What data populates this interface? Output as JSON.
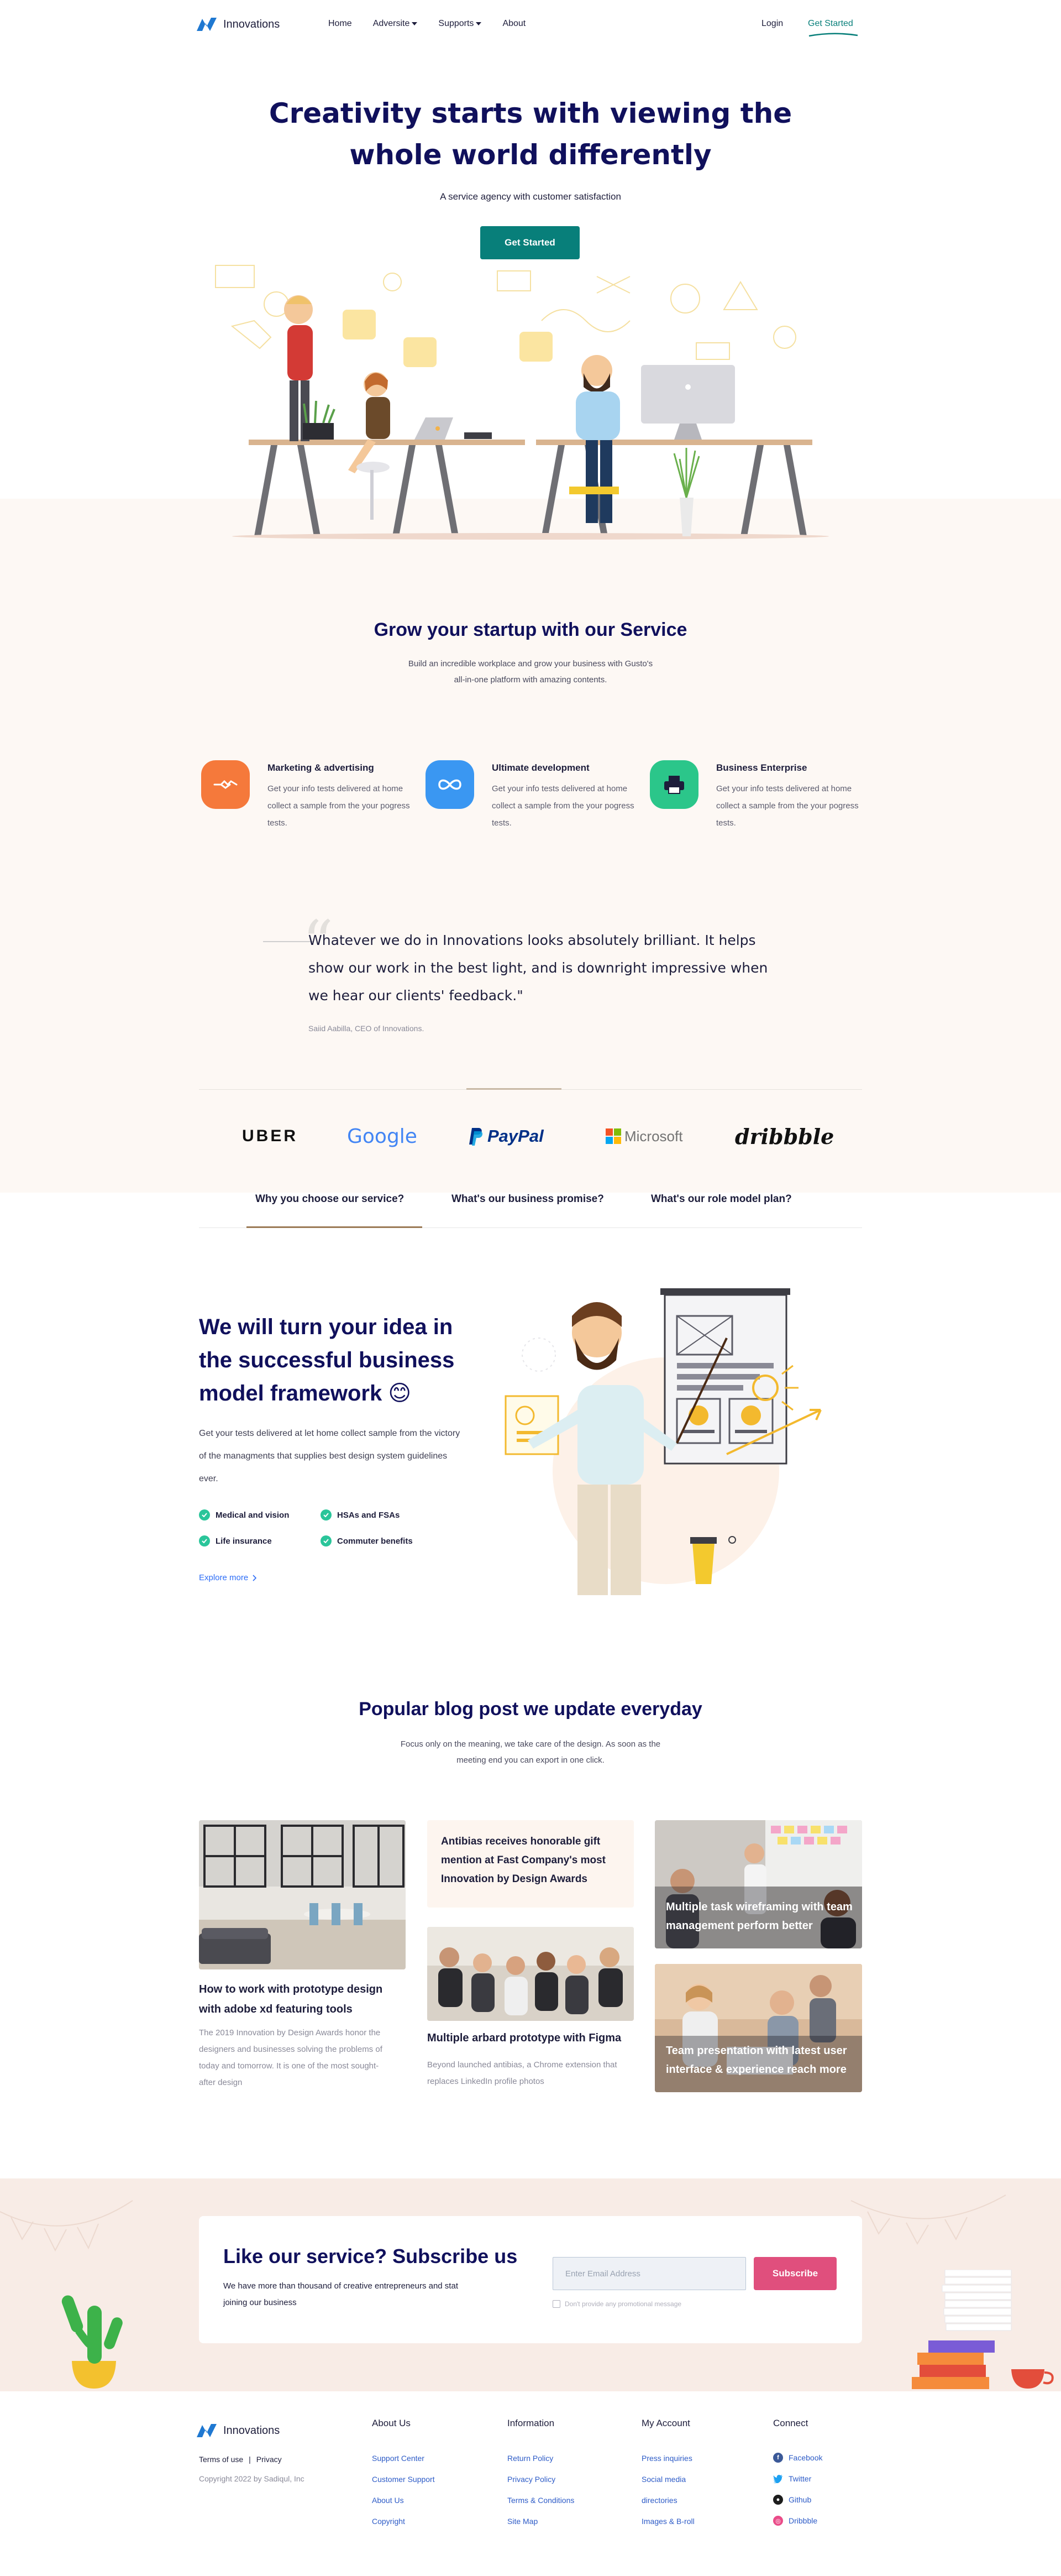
{
  "nav": {
    "logo_text": "Innovations",
    "links": [
      {
        "label": "Home",
        "dropdown": false
      },
      {
        "label": "Adversite",
        "dropdown": true
      },
      {
        "label": "Supports",
        "dropdown": true
      },
      {
        "label": "About",
        "dropdown": false
      }
    ],
    "login": "Login",
    "cta": "Get Started"
  },
  "hero": {
    "title_line1": "Creativity starts with viewing the",
    "title_line2": "whole world differently",
    "subtitle": "A service agency with customer satisfaction",
    "button": "Get Started"
  },
  "services": {
    "title": "Grow your startup with our Service",
    "subtitle_line1": "Build an incredible workplace and grow your business with Gusto's",
    "subtitle_line2": "all-in-one platform with amazing contents.",
    "features": [
      {
        "title": "Marketing & advertising",
        "text": "Get your info tests delivered at home collect a sample from the your pogress tests.",
        "icon": "handshake-icon",
        "color": "#f5793b"
      },
      {
        "title": "Ultimate development",
        "text": "Get your info tests delivered at home collect a sample from the your pogress tests.",
        "icon": "infinity-icon",
        "color": "#3a97f2"
      },
      {
        "title": "Business Enterprise",
        "text": "Get your info tests delivered at home collect a sample from the your pogress tests.",
        "icon": "printer-icon",
        "color": "#2bc68a"
      }
    ]
  },
  "testimonial": {
    "quote": "Whatever we do in Innovations looks absolutely brilliant. It helps show our work in the best light, and is downright impressive when we hear our clients' feedback.\"",
    "author": "Saiid Aabilla, CEO of Innovations."
  },
  "brands": [
    "UBER",
    "Google",
    "PayPal",
    "Microsoft",
    "dribbble"
  ],
  "tabs": [
    "Why you choose our service?",
    "What's our business promise?",
    "What's our role model plan?"
  ],
  "idea": {
    "title_line1": "We will turn your idea in",
    "title_line2": "the successful business",
    "title_line3": "model framework",
    "emoji": "😊",
    "text": "Get your tests delivered at let home collect sample from the victory of the managments that supplies best design system guidelines ever.",
    "checks": [
      "Medical and vision",
      "HSAs and FSAs",
      "Life insurance",
      "Commuter benefits"
    ],
    "explore": "Explore more"
  },
  "blog": {
    "title": "Popular blog post we update everyday",
    "subtitle_line1": "Focus only on the meaning, we take care of the design. As soon as the",
    "subtitle_line2": "meeting end you can export in one click.",
    "posts": [
      {
        "title": "How to work with prototype design with adobe xd featuring tools",
        "text": "The 2019 Innovation by Design Awards honor the designers and businesses solving the problems of today and tomorrow. It is one of the most sought-after design"
      },
      {
        "title": "Antibias receives honorable gift mention at Fast Company's most Innovation by Design Awards"
      },
      {
        "title": "Multiple arbard prototype with Figma",
        "text": "Beyond launched antibias, a Chrome extension that replaces LinkedIn profile photos"
      },
      {
        "title": "Multiple task wireframing with team management perform better"
      },
      {
        "title": "Team presentation with latest user interface & experience reach more"
      }
    ]
  },
  "subscribe": {
    "title": "Like our service? Subscribe us",
    "text": "We have more than thousand of creative entrepreneurs and stat joining our business",
    "placeholder": "Enter Email Address",
    "button": "Subscribe",
    "checkbox": "Don't provide any promotional message"
  },
  "footer": {
    "logo_text": "Innovations",
    "terms": "Terms of use",
    "privacy": "Privacy",
    "copyright": "Copyright 2022 by Sadiqul, Inc",
    "columns": [
      {
        "title": "About Us",
        "links": [
          "Support Center",
          "Customer Support",
          "About Us",
          "Copyright"
        ]
      },
      {
        "title": "Information",
        "links": [
          "Return Policy",
          "Privacy Policy",
          "Terms & Conditions",
          "Site Map"
        ]
      },
      {
        "title": "My Account",
        "links": [
          "Press inquiries",
          "Social media",
          "directories",
          "Images & B-roll"
        ]
      }
    ],
    "connect": {
      "title": "Connect",
      "items": [
        {
          "label": "Facebook",
          "icon": "facebook-icon",
          "color": "#3b5998"
        },
        {
          "label": "Twitter",
          "icon": "twitter-icon",
          "color": "#1da1f2"
        },
        {
          "label": "Github",
          "icon": "github-icon",
          "color": "#1d1d1d"
        },
        {
          "label": "Dribbble",
          "icon": "dribbble-icon",
          "color": "#ea4c89"
        }
      ]
    }
  },
  "colors": {
    "accent": "#087f7a",
    "heading": "#10105c",
    "cream": "#fdf8f4",
    "subscribe": "#e04f7d"
  }
}
